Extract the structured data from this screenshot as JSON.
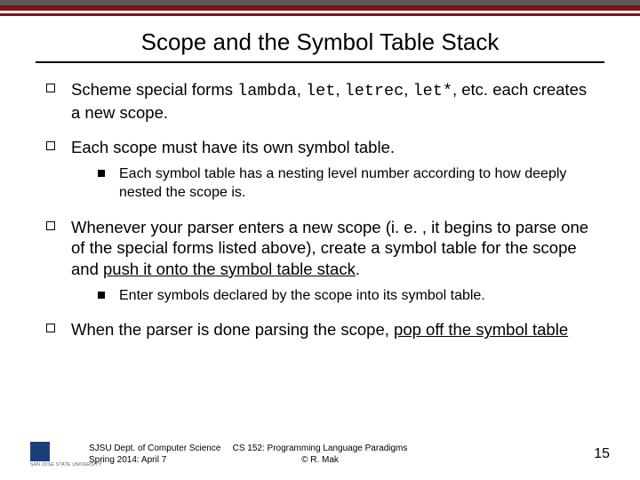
{
  "title": "Scope and the Symbol Table Stack",
  "bullets": [
    {
      "pre": "Scheme special forms ",
      "code1": "lambda",
      "sep1": ", ",
      "code2": "let",
      "sep2": ", ",
      "code3": "letrec",
      "sep3": ", ",
      "code4": "let*",
      "post": ", etc. each creates a new scope.",
      "sub": []
    },
    {
      "pre": "Each scope must have its own symbol table.",
      "sub": [
        "Each symbol table has a nesting level number according to how deeply nested the scope is."
      ]
    },
    {
      "pre": "Whenever your parser enters a new scope (i. e. , it begins to parse one of the special forms listed above), create a symbol table for the scope and ",
      "u": "push it onto the symbol table stack",
      "post": ".",
      "sub": [
        "Enter symbols declared by the scope into its symbol table."
      ]
    },
    {
      "pre": "When the parser is done parsing the scope, ",
      "u": "pop off the symbol table",
      "sub": []
    }
  ],
  "footer": {
    "left_l1": "SJSU Dept. of Computer Science",
    "left_l2": "Spring 2014: April 7",
    "center_l1": "CS 152: Programming Language Paradigms",
    "center_l2": "© R. Mak",
    "page": "15",
    "logo_text": "SAN JOSE STATE\nUNIVERSITY"
  }
}
